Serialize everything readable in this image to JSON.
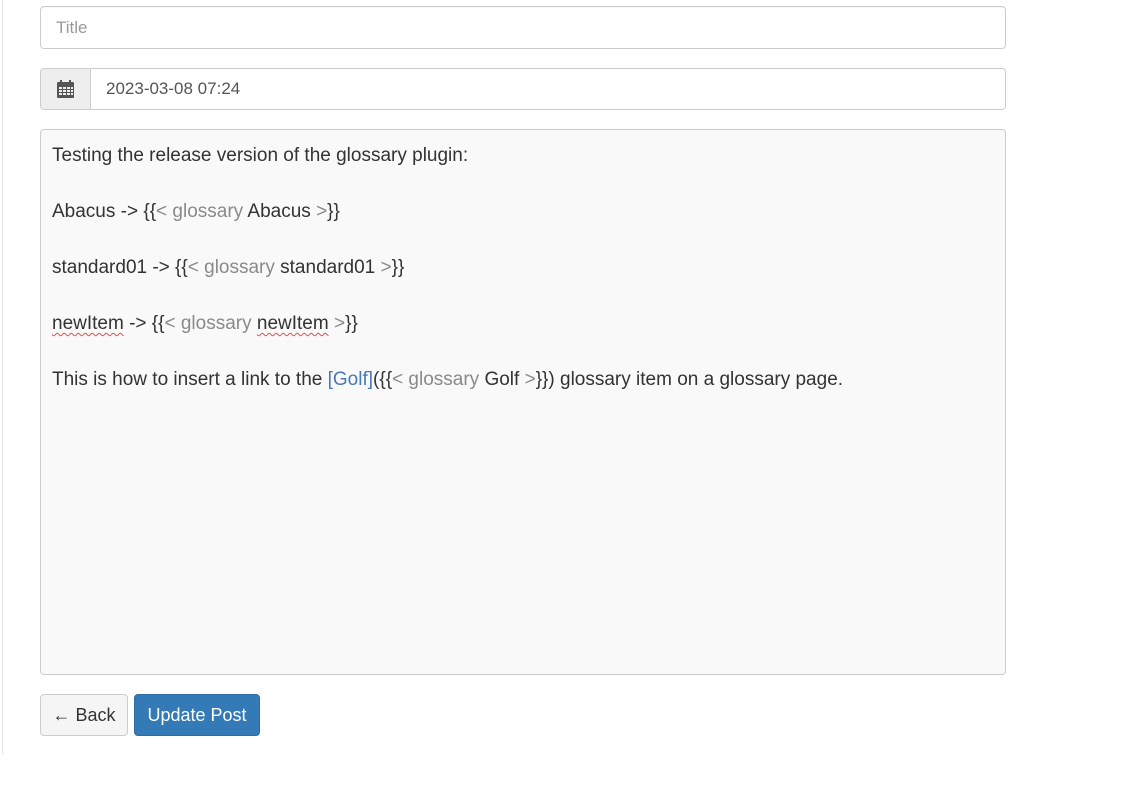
{
  "form": {
    "title_placeholder": "Title",
    "title_value": "",
    "date_value": "2023-03-08 07:24",
    "date_icon": "calendar-icon"
  },
  "editor": {
    "line1": "Testing the release version of the glossary plugin:",
    "line2": {
      "lead": "Abacus -> {{",
      "sc_open": "< glossary",
      "arg": " Abacus ",
      "sc_close": ">",
      "tail": "}}"
    },
    "line3": {
      "lead": "standard01 -> {{",
      "sc_open": "< glossary",
      "arg": " standard01 ",
      "sc_close": ">",
      "tail": "}}"
    },
    "line4": {
      "word1": "newItem",
      "mid": " -> {{",
      "sc_open": "< glossary",
      "space": " ",
      "word2": "newItem",
      "space2": " ",
      "sc_close": ">",
      "tail": "}}"
    },
    "line5": {
      "lead": "This is how to insert a link to the ",
      "link": "[Golf]",
      "paren": "({{",
      "sc_open": "< glossary",
      "arg": " Golf ",
      "sc_close": ">",
      "tail": "}}) glossary item on a glossary page."
    }
  },
  "buttons": {
    "back_label": "← Back",
    "update_label": "Update Post"
  },
  "colors": {
    "primary": "#337ab7",
    "shortcode_gray": "#8a8a8a",
    "link_blue": "#4a78b5",
    "editor_bg": "#f9f9f9"
  }
}
